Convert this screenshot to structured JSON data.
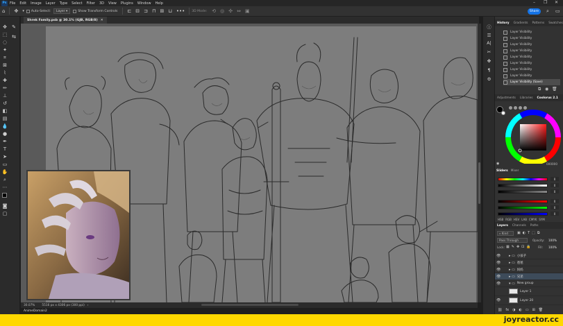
{
  "menu": {
    "app_logo": "Ps",
    "items": [
      "File",
      "Edit",
      "Image",
      "Layer",
      "Type",
      "Select",
      "Filter",
      "3D",
      "View",
      "Plugins",
      "Window",
      "Help"
    ]
  },
  "window_controls": {
    "minimize": "–",
    "maximize": "❐",
    "close": "✕"
  },
  "options_bar": {
    "auto_select_label": "Auto-Select:",
    "auto_select_value": "Layer",
    "show_transform_label": "Show Transform Controls",
    "mode_3d_label": "3D Mode:",
    "share_label": "Share"
  },
  "document": {
    "tab_title": "Shrek Family.psb @ 30.1% (GJB, RGB/8)",
    "zoom": "30.07%",
    "dimensions": "5516 px x 4306 px (300 ppi)"
  },
  "taskbar": {
    "title": "AnimeDomain2"
  },
  "history": {
    "tabs": [
      "History",
      "Gradients",
      "Patterns",
      "Swatches"
    ],
    "items": [
      "Layer Visibility",
      "Layer Visibility",
      "Layer Visibility",
      "Layer Visibility",
      "Layer Visibility",
      "Layer Visibility",
      "Layer Visibility",
      "Layer Visibility",
      "Layer Visibility (Save)"
    ]
  },
  "color_panel": {
    "tabs": [
      "Adjustments",
      "Libraries",
      "Coolorus 2.1"
    ],
    "hex_value": "000000",
    "sliders_tabs": [
      "Sliders",
      "Mixer"
    ],
    "slider_values": [
      "0",
      "0",
      "0",
      "0",
      "0",
      "0"
    ],
    "mode_labels": [
      "RGB",
      "HSV",
      "LAB",
      "CMYK",
      "SYM"
    ],
    "mode_prefix": "HSB"
  },
  "layers": {
    "tabs": [
      "Layers",
      "Channels",
      "Paths"
    ],
    "kind_label": "Kind",
    "blend_mode": "Pass Through",
    "opacity_label": "Opacity:",
    "opacity_value": "100%",
    "lock_label": "Lock:",
    "fill_label": "Fill:",
    "fill_value": "100%",
    "items": [
      {
        "name": "小孩子",
        "type": "group"
      },
      {
        "name": "爸爸",
        "type": "group"
      },
      {
        "name": "妈妈",
        "type": "group"
      },
      {
        "name": "兄弟",
        "type": "group"
      },
      {
        "name": "New group",
        "type": "group"
      },
      {
        "name": "Layer 1",
        "type": "layer"
      },
      {
        "name": "Layer 20",
        "type": "layer"
      }
    ]
  },
  "watermark": {
    "text": "joyreactor.cc"
  },
  "colors": {
    "accent": "#1473e6",
    "canvas": "#555555",
    "panel": "#323232",
    "watermark_bg": "#ffd800"
  }
}
